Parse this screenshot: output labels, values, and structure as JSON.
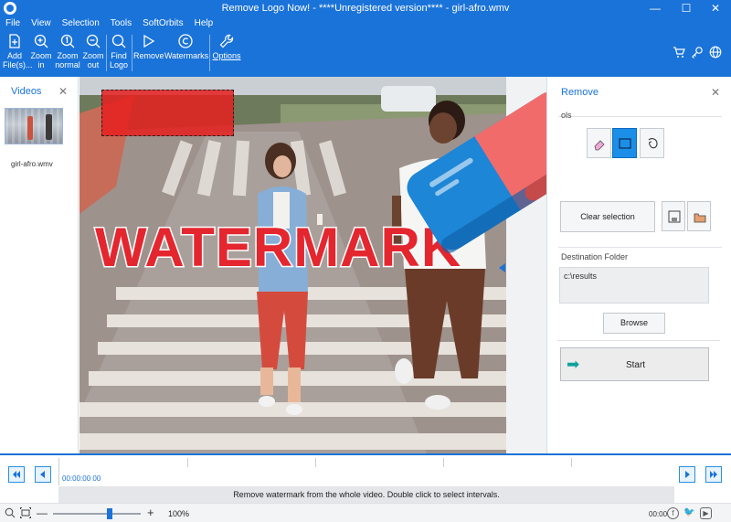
{
  "window": {
    "title": "Remove Logo Now! - ****Unregistered version**** - girl-afro.wmv",
    "controls": {
      "minimize": "—",
      "maximize": "☐",
      "close": "✕"
    }
  },
  "menu": [
    "File",
    "View",
    "Selection",
    "Tools",
    "SoftOrbits",
    "Help"
  ],
  "toolbar": {
    "add_files": "Add\nFile(s)...",
    "zoom_in": "Zoom\nin",
    "zoom_normal": "Zoom\nnormal",
    "zoom_out": "Zoom\nout",
    "find_logo": "Find\nLogo",
    "remove": "Remove",
    "watermarks": "Watermarks",
    "options": "Options"
  },
  "videos_panel": {
    "title": "Videos",
    "close": "✕",
    "items": [
      {
        "label": "girl-afro.wmv"
      }
    ]
  },
  "video": {
    "watermark_text": "WATERMARK"
  },
  "remove_panel": {
    "title": "Remove",
    "close": "✕",
    "tools_label": "ols",
    "clear_selection": "Clear selection",
    "destination_label": "Destination Folder",
    "destination_path": "c:\\results",
    "browse": "Browse",
    "start": "Start"
  },
  "timeline": {
    "time": "00:00:00 00",
    "message": "Remove watermark from the whole video. Double click to select intervals."
  },
  "statusbar": {
    "minus": "—",
    "plus": "+",
    "zoom": "100%",
    "zoom_level": 0.65,
    "time": "00:00"
  },
  "colors": {
    "accent": "#1a73d9",
    "watermark": "#e4262f",
    "selection": "#e61e1e",
    "start_arrow": "#0fa19a"
  },
  "icons": [
    "add-file-icon",
    "zoom-in-icon",
    "zoom-normal-icon",
    "zoom-out-icon",
    "find-logo-icon",
    "play-icon",
    "copyright-icon",
    "wrench-icon",
    "cart-icon",
    "key-icon",
    "globe-icon",
    "eraser-icon",
    "rectangle-select-icon",
    "lasso-icon",
    "save-mask-icon",
    "load-mask-icon"
  ]
}
